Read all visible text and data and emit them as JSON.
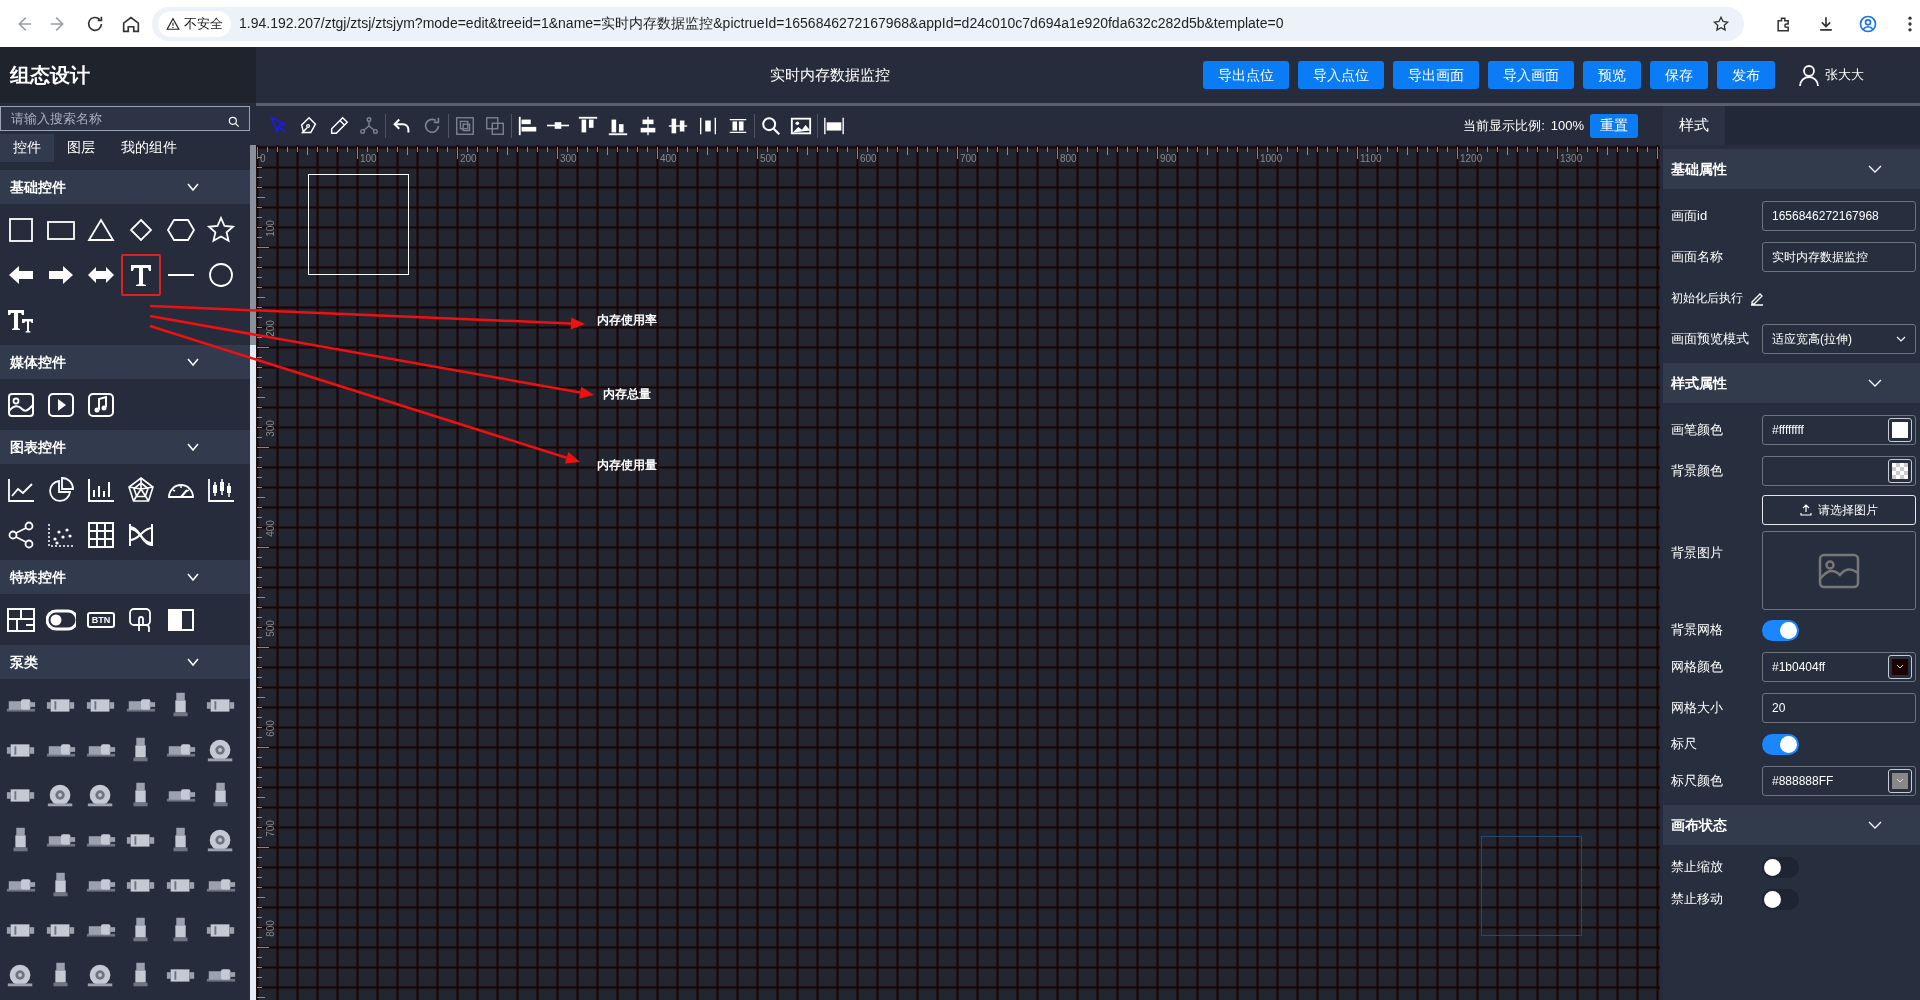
{
  "browser": {
    "security": "不安全",
    "url": "1.94.192.207/ztgj/ztsj/ztsjym?mode=edit&treeid=1&name=实时内存数据监控&pictrueId=1656846272167968&appId=d24c010c7d694a1e920fda632c282d5b&template=0"
  },
  "app": {
    "title": "组态设计"
  },
  "header": {
    "page_title": "实时内存数据监控",
    "buttons": [
      "导出点位",
      "导入点位",
      "导出画面",
      "导入画面",
      "预览",
      "保存",
      "发布"
    ],
    "user": "张大大"
  },
  "sidebar": {
    "search_placeholder": "请输入搜索名称",
    "tabs": [
      {
        "label": "控件",
        "selected": true
      },
      {
        "label": "图层",
        "selected": false
      },
      {
        "label": "我的组件",
        "selected": false
      }
    ],
    "sections": [
      {
        "title": "基础控件",
        "expanded": true,
        "items": [
          {
            "kind": "square",
            "selected": false
          },
          {
            "kind": "rect",
            "selected": false
          },
          {
            "kind": "triangle",
            "selected": false
          },
          {
            "kind": "diamond",
            "selected": false
          },
          {
            "kind": "hexagon",
            "selected": false
          },
          {
            "kind": "star",
            "selected": false
          },
          {
            "kind": "arrow-left",
            "selected": false
          },
          {
            "kind": "arrow-right",
            "selected": false
          },
          {
            "kind": "arrow-both",
            "selected": false
          },
          {
            "kind": "text",
            "selected": true
          },
          {
            "kind": "line",
            "selected": false
          },
          {
            "kind": "circle",
            "selected": false
          },
          {
            "kind": "text-size",
            "selected": false
          }
        ]
      },
      {
        "title": "媒体控件",
        "expanded": true,
        "items": [
          {
            "kind": "image"
          },
          {
            "kind": "video"
          },
          {
            "kind": "audio"
          }
        ]
      },
      {
        "title": "图表控件",
        "expanded": true,
        "items": [
          {
            "kind": "line-chart"
          },
          {
            "kind": "pie-chart"
          },
          {
            "kind": "bar-chart"
          },
          {
            "kind": "radar-chart"
          },
          {
            "kind": "gauge"
          },
          {
            "kind": "candlestick"
          },
          {
            "kind": "graph"
          },
          {
            "kind": "scatter"
          },
          {
            "kind": "table"
          },
          {
            "kind": "sankey"
          }
        ]
      },
      {
        "title": "特殊控件",
        "expanded": true,
        "items": [
          {
            "kind": "layout"
          },
          {
            "kind": "switch"
          },
          {
            "kind": "btn",
            "label": "BTN"
          },
          {
            "kind": "touch"
          },
          {
            "kind": "panel"
          }
        ]
      },
      {
        "title": "泵类",
        "expanded": true,
        "items": [
          {
            "kind": "motor-pump"
          },
          {
            "kind": "inline-pump"
          },
          {
            "kind": "inline-pump"
          },
          {
            "kind": "motor-pump"
          },
          {
            "kind": "vertical-pump"
          },
          {
            "kind": "inline-pump"
          },
          {
            "kind": "inline-pump"
          },
          {
            "kind": "motor-pump"
          },
          {
            "kind": "motor-pump"
          },
          {
            "kind": "vertical-pump"
          },
          {
            "kind": "motor-pump"
          },
          {
            "kind": "centrifugal-pump"
          },
          {
            "kind": "inline-pump"
          },
          {
            "kind": "centrifugal-pump"
          },
          {
            "kind": "centrifugal-pump"
          },
          {
            "kind": "vertical-pump"
          },
          {
            "kind": "motor-pump"
          },
          {
            "kind": "vertical-pump"
          },
          {
            "kind": "vertical-pump"
          },
          {
            "kind": "motor-pump"
          },
          {
            "kind": "motor-pump"
          },
          {
            "kind": "inline-pump"
          },
          {
            "kind": "vertical-pump"
          },
          {
            "kind": "centrifugal-pump"
          },
          {
            "kind": "motor-pump"
          },
          {
            "kind": "vertical-pump"
          },
          {
            "kind": "motor-pump"
          },
          {
            "kind": "inline-pump"
          },
          {
            "kind": "inline-pump"
          },
          {
            "kind": "motor-pump"
          },
          {
            "kind": "inline-pump"
          },
          {
            "kind": "inline-pump"
          },
          {
            "kind": "motor-pump"
          },
          {
            "kind": "vertical-pump"
          },
          {
            "kind": "vertical-pump"
          },
          {
            "kind": "inline-pump"
          },
          {
            "kind": "centrifugal-pump"
          },
          {
            "kind": "vertical-pump"
          },
          {
            "kind": "centrifugal-pump"
          },
          {
            "kind": "vertical-pump"
          },
          {
            "kind": "inline-pump"
          },
          {
            "kind": "motor-pump"
          }
        ]
      }
    ]
  },
  "toolbar": {
    "tools": [
      {
        "kind": "select",
        "selected": true,
        "disabled": false
      },
      {
        "kind": "pen",
        "selected": false,
        "disabled": false
      },
      {
        "kind": "pencil",
        "selected": false,
        "disabled": false
      },
      {
        "kind": "nodes",
        "selected": false,
        "disabled": true
      },
      {
        "kind": "undo",
        "selected": false,
        "disabled": false
      },
      {
        "kind": "redo",
        "selected": false,
        "disabled": true
      },
      {
        "kind": "group",
        "selected": false,
        "disabled": true
      },
      {
        "kind": "ungroup",
        "selected": false,
        "disabled": true
      },
      {
        "kind": "align-left",
        "selected": false,
        "disabled": false
      },
      {
        "kind": "align-middle",
        "selected": false,
        "disabled": false
      },
      {
        "kind": "align-top",
        "selected": false,
        "disabled": false
      },
      {
        "kind": "align-bottom",
        "selected": false,
        "disabled": false
      },
      {
        "kind": "align-center",
        "selected": false,
        "disabled": false
      },
      {
        "kind": "align-vcenter",
        "selected": false,
        "disabled": false
      },
      {
        "kind": "distribute-h",
        "selected": false,
        "disabled": false
      },
      {
        "kind": "distribute-v",
        "selected": false,
        "disabled": false
      },
      {
        "kind": "zoom",
        "selected": false,
        "disabled": false
      },
      {
        "kind": "image",
        "selected": false,
        "disabled": false
      },
      {
        "kind": "fullscreen",
        "selected": false,
        "disabled": false
      }
    ],
    "scale_label": "当前显示比例:",
    "scale_value": "100%",
    "reset": "重置"
  },
  "canvas": {
    "x_labels": [
      "0",
      "100",
      "200",
      "300",
      "400",
      "500",
      "600",
      "700",
      "800",
      "900",
      "1000",
      "1100",
      "1200",
      "1300"
    ],
    "y_labels": [
      "100",
      "200",
      "300",
      "400",
      "500",
      "600",
      "700",
      "800"
    ],
    "elements": [
      {
        "kind": "rect"
      },
      {
        "kind": "text",
        "text": "内存使用率"
      },
      {
        "kind": "text",
        "text": "内存总量"
      },
      {
        "kind": "text",
        "text": "内存使用量"
      },
      {
        "kind": "frame"
      }
    ],
    "annotations": [
      {
        "kind": "arrow"
      },
      {
        "kind": "arrow"
      },
      {
        "kind": "arrow"
      }
    ]
  },
  "panel": {
    "tabs": [
      {
        "label": "样式",
        "selected": true
      }
    ],
    "sections": [
      {
        "title": "基础属性",
        "expanded": true,
        "fields": [
          {
            "kind": "text",
            "label": "画面id",
            "value": "1656846272167968"
          },
          {
            "kind": "text",
            "label": "画面名称",
            "value": "实时内存数据监控"
          },
          {
            "kind": "edit",
            "label": "初始化后执行"
          },
          {
            "kind": "select",
            "label": "画面预览模式",
            "value": "适应宽高(拉伸)"
          }
        ]
      },
      {
        "title": "样式属性",
        "expanded": true,
        "fields": [
          {
            "kind": "color",
            "label": "画笔颜色",
            "value": "#ffffffff"
          },
          {
            "kind": "color",
            "label": "背景颜色"
          },
          {
            "kind": "upload",
            "label": "背景图片",
            "button": "请选择图片"
          },
          {
            "kind": "toggle",
            "label": "背景网格",
            "on": true
          },
          {
            "kind": "color",
            "label": "网格颜色",
            "value": "#1b0404ff"
          },
          {
            "kind": "text",
            "label": "网格大小",
            "value": "20"
          },
          {
            "kind": "toggle",
            "label": "标尺",
            "on": true
          },
          {
            "kind": "color",
            "label": "标尺颜色",
            "value": "#888888FF"
          }
        ]
      },
      {
        "title": "画布状态",
        "expanded": true,
        "fields": [
          {
            "kind": "toggle",
            "label": "禁止缩放",
            "on": false
          },
          {
            "kind": "toggle",
            "label": "禁止移动",
            "on": false
          }
        ]
      }
    ]
  }
}
